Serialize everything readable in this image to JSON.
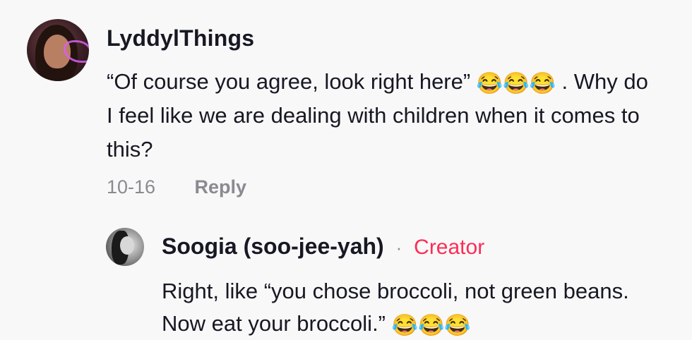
{
  "comment": {
    "username": "LyddylThings",
    "text_line1": "“Of course you agree, look right here” ",
    "emojis_line1": "😂😂😂",
    "text_line1_end": " . Why do",
    "text_line2": "I feel like we are dealing with children when it comes to",
    "text_line3": "this?",
    "date": "10-16",
    "reply_label": "Reply"
  },
  "reply": {
    "username": "Soogia (soo-jee-yah)",
    "separator": "·",
    "creator_label": "Creator",
    "text_line1": "Right, like “you chose broccoli, not green beans.",
    "text_line2": "Now eat your broccoli.” ",
    "emojis_line2": "😂😂😂"
  },
  "colors": {
    "background": "#f8f8f8",
    "primary_text": "#161823",
    "secondary_text": "#8a8b91",
    "creator_accent": "#fe2c55"
  }
}
